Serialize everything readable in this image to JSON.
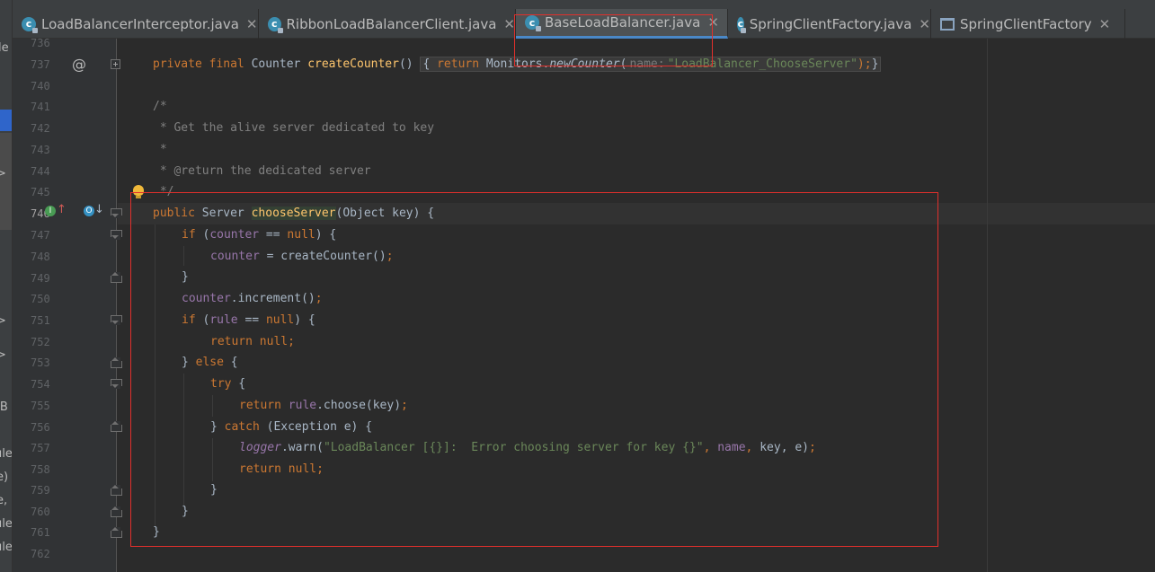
{
  "left_strip": {
    "fragments": [
      "le",
      "e",
      ">",
      "JB",
      "ule",
      "e)",
      "e,",
      "ule",
      "ule"
    ]
  },
  "tabs": [
    {
      "label": "LoadBalancerInterceptor.java",
      "icon": "class-icon",
      "active": false
    },
    {
      "label": "RibbonLoadBalancerClient.java",
      "icon": "class-icon",
      "active": false
    },
    {
      "label": "BaseLoadBalancer.java",
      "icon": "class-icon",
      "active": true
    },
    {
      "label": "SpringClientFactory.java",
      "icon": "class-icon",
      "active": false
    },
    {
      "label": "SpringClientFactory",
      "icon": "structure-icon",
      "active": false
    }
  ],
  "close_glyph": "✕",
  "gutter": {
    "line_numbers": [
      "736",
      "737",
      "740",
      "741",
      "742",
      "743",
      "744",
      "745",
      "746",
      "747",
      "748",
      "749",
      "750",
      "751",
      "752",
      "753",
      "754",
      "755",
      "756",
      "757",
      "758",
      "759",
      "760",
      "761",
      "762"
    ],
    "at_marker": "@",
    "impl_marker": "I",
    "impl_arrow": "↑",
    "ovr_marker": "O",
    "ovr_arrow": "↓"
  },
  "code": {
    "l737": {
      "kw1": "private final ",
      "type": "Counter ",
      "fn": "createCounter",
      "paren": "()",
      "open": "{ ",
      "ret": "return ",
      "cls": "Monitors.",
      "method": "newCounter",
      "po": "(",
      "hint": "name:",
      "arg": "\"LoadBalancer_ChooseServer\"",
      "end": ");",
      "close": "}"
    },
    "l741": "/*",
    "l742": " * Get the alive server dedicated to key",
    "l743": " *",
    "l744": " * @return the dedicated server",
    "l745": " */",
    "l746": {
      "kw": "public ",
      "type": "Server ",
      "fn": "chooseServer",
      "rest": "(Object key) {"
    },
    "l747": {
      "kw": "if ",
      "p1": "(",
      "fld": "counter",
      "op": " == ",
      "nul": "null",
      "p2": ") {"
    },
    "l748": {
      "fld": "counter",
      "rest": " = createCounter()",
      "semi": ";"
    },
    "l749": "}",
    "l750": {
      "fld": "counter",
      "rest": ".increment()",
      "semi": ";"
    },
    "l751": {
      "kw": "if ",
      "p1": "(",
      "fld": "rule",
      "op": " == ",
      "nul": "null",
      "p2": ") {"
    },
    "l752": {
      "kw": "return ",
      "nul": "null",
      "semi": ";"
    },
    "l753": {
      "b": "} ",
      "kw": "else",
      "rest": " {"
    },
    "l754": {
      "kw": "try",
      "rest": " {"
    },
    "l755": {
      "kw": "return ",
      "fld": "rule",
      "rest": ".choose(key)",
      "semi": ";"
    },
    "l756": {
      "b": "} ",
      "kw": "catch",
      "rest": " (Exception e) {"
    },
    "l757": {
      "fld": "logger",
      "rest": ".warn(",
      "str": "\"LoadBalancer [{}]:  Error choosing server for key {}\"",
      "c1": ", ",
      "name": "name",
      "c2": ", ",
      "key": "key",
      "c3": ", e)",
      "semi": ";"
    },
    "l758": {
      "kw": "return ",
      "nul": "null",
      "semi": ";"
    },
    "l759": "}",
    "l760": "}",
    "l761": "}"
  },
  "colors": {
    "accent_red": "#e0302c",
    "keyword": "#cc7832",
    "field": "#9876aa",
    "string": "#6a8759",
    "comment": "#808080",
    "method": "#ffc66d"
  }
}
